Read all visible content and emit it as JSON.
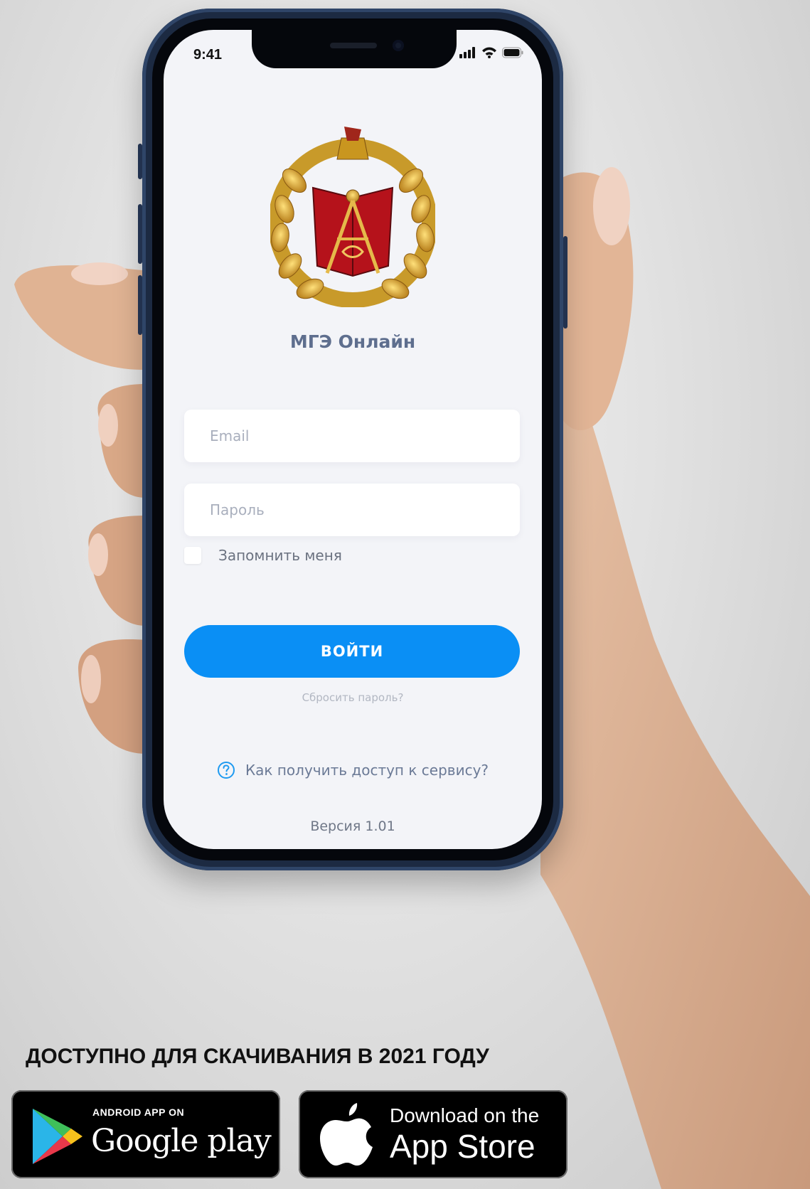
{
  "status_bar": {
    "time": "9:41"
  },
  "app": {
    "title": "МГЭ Онлайн",
    "email_placeholder": "Email",
    "password_placeholder": "Пароль",
    "remember_label": "Запомнить меня",
    "login_label": "ВОЙТИ",
    "reset_label": "Сбросить пароль?",
    "help_label": "Как получить доступ к сервису?",
    "version": "Версия 1.01"
  },
  "promo": {
    "headline": "ДОСТУПНО ДЛЯ СКАЧИВАНИЯ В 2021 ГОДУ",
    "google_play": {
      "small": "ANDROID APP ON",
      "big": "Google play"
    },
    "app_store": {
      "small": "Download on the",
      "big": "App Store"
    }
  },
  "colors": {
    "accent": "#0a8ff5",
    "title": "#5e6e8e",
    "screen_bg": "#f3f4f8",
    "phone_frame": "#1c2a42"
  },
  "icons": [
    "signal-icon",
    "wifi-icon",
    "battery-icon",
    "emblem-logo",
    "help-circle-icon",
    "google-play-icon",
    "apple-icon"
  ]
}
